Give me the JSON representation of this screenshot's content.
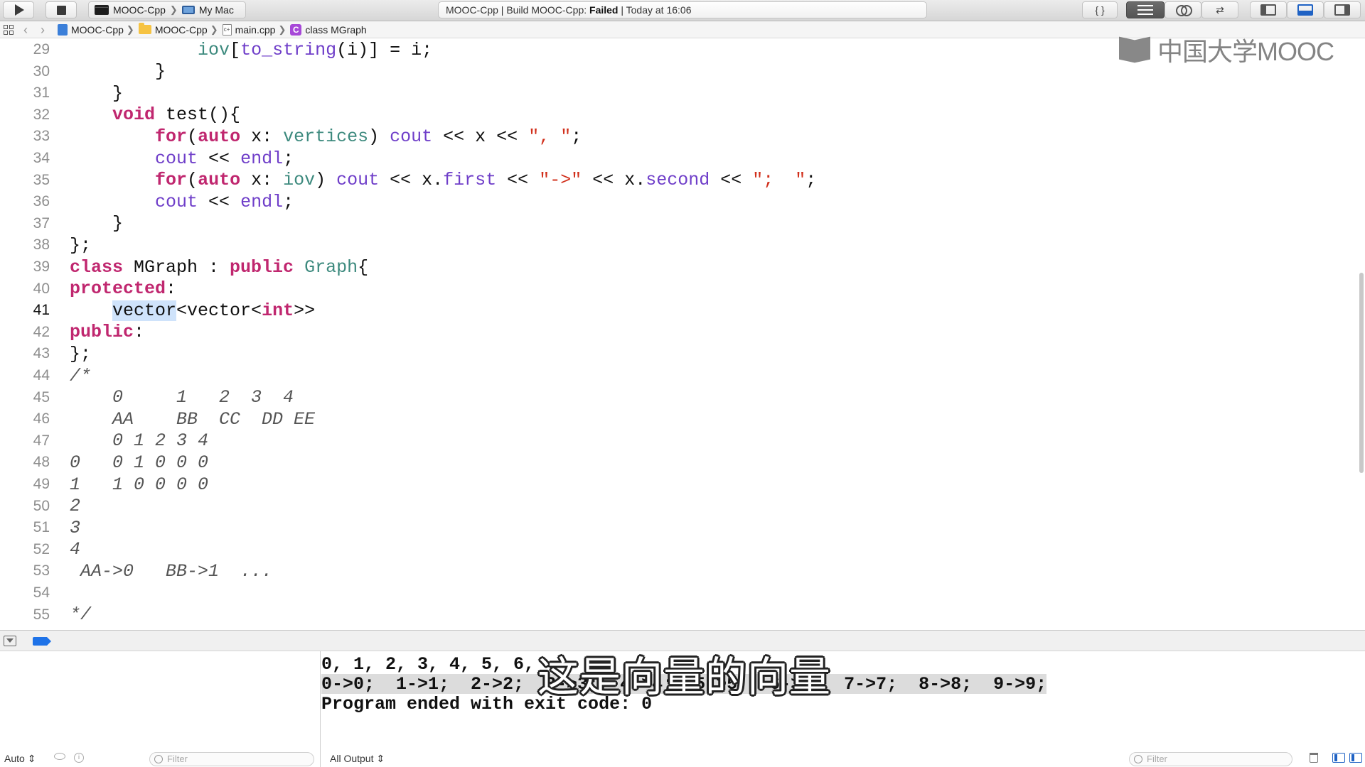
{
  "toolbar": {
    "scheme_target": "MOOC-Cpp",
    "scheme_destination": "My Mac",
    "activity_prefix": "MOOC-Cpp | Build MOOC-Cpp: ",
    "activity_status": "Failed",
    "activity_suffix": " | Today at 16:06",
    "braces_label": "{ }"
  },
  "jumpbar": {
    "crumbs": [
      "MOOC-Cpp",
      "MOOC-Cpp",
      "main.cpp",
      "class MGraph"
    ]
  },
  "watermark": {
    "text": "中国大学MOOC"
  },
  "editor": {
    "current_line": "41",
    "lines": [
      {
        "n": "29",
        "tokens": [
          {
            "t": "            ",
            "c": ""
          },
          {
            "t": "iov",
            "c": "type"
          },
          {
            "t": "[",
            "c": ""
          },
          {
            "t": "to_string",
            "c": "method"
          },
          {
            "t": "(i)] = i;",
            "c": ""
          }
        ]
      },
      {
        "n": "30",
        "tokens": [
          {
            "t": "        }",
            "c": ""
          }
        ]
      },
      {
        "n": "31",
        "tokens": [
          {
            "t": "    }",
            "c": ""
          }
        ]
      },
      {
        "n": "32",
        "tokens": [
          {
            "t": "    ",
            "c": ""
          },
          {
            "t": "void",
            "c": "keyword"
          },
          {
            "t": " test(){",
            "c": ""
          }
        ]
      },
      {
        "n": "33",
        "tokens": [
          {
            "t": "        ",
            "c": ""
          },
          {
            "t": "for",
            "c": "keyword"
          },
          {
            "t": "(",
            "c": ""
          },
          {
            "t": "auto",
            "c": "keyword"
          },
          {
            "t": " x: ",
            "c": ""
          },
          {
            "t": "vertices",
            "c": "type"
          },
          {
            "t": ") ",
            "c": ""
          },
          {
            "t": "cout",
            "c": "method"
          },
          {
            "t": " << x << ",
            "c": ""
          },
          {
            "t": "\", \"",
            "c": "string"
          },
          {
            "t": ";",
            "c": ""
          }
        ]
      },
      {
        "n": "34",
        "tokens": [
          {
            "t": "        ",
            "c": ""
          },
          {
            "t": "cout",
            "c": "method"
          },
          {
            "t": " << ",
            "c": ""
          },
          {
            "t": "endl",
            "c": "method"
          },
          {
            "t": ";",
            "c": ""
          }
        ]
      },
      {
        "n": "35",
        "tokens": [
          {
            "t": "        ",
            "c": ""
          },
          {
            "t": "for",
            "c": "keyword"
          },
          {
            "t": "(",
            "c": ""
          },
          {
            "t": "auto",
            "c": "keyword"
          },
          {
            "t": " x: ",
            "c": ""
          },
          {
            "t": "iov",
            "c": "type"
          },
          {
            "t": ") ",
            "c": ""
          },
          {
            "t": "cout",
            "c": "method"
          },
          {
            "t": " << x.",
            "c": ""
          },
          {
            "t": "first",
            "c": "method"
          },
          {
            "t": " << ",
            "c": ""
          },
          {
            "t": "\"->\"",
            "c": "string"
          },
          {
            "t": " << x.",
            "c": ""
          },
          {
            "t": "second",
            "c": "method"
          },
          {
            "t": " << ",
            "c": ""
          },
          {
            "t": "\";  \"",
            "c": "string"
          },
          {
            "t": ";",
            "c": ""
          }
        ]
      },
      {
        "n": "36",
        "tokens": [
          {
            "t": "        ",
            "c": ""
          },
          {
            "t": "cout",
            "c": "method"
          },
          {
            "t": " << ",
            "c": ""
          },
          {
            "t": "endl",
            "c": "method"
          },
          {
            "t": ";",
            "c": ""
          }
        ]
      },
      {
        "n": "37",
        "tokens": [
          {
            "t": "    }",
            "c": ""
          }
        ]
      },
      {
        "n": "38",
        "tokens": [
          {
            "t": "};",
            "c": ""
          }
        ]
      },
      {
        "n": "39",
        "tokens": [
          {
            "t": "class",
            "c": "keyword"
          },
          {
            "t": " MGraph : ",
            "c": ""
          },
          {
            "t": "public",
            "c": "keyword"
          },
          {
            "t": " ",
            "c": ""
          },
          {
            "t": "Graph",
            "c": "type"
          },
          {
            "t": "{",
            "c": ""
          }
        ]
      },
      {
        "n": "40",
        "tokens": [
          {
            "t": "protected",
            "c": "keyword"
          },
          {
            "t": ":",
            "c": ""
          }
        ]
      },
      {
        "n": "41",
        "tokens": [
          {
            "t": "    ",
            "c": ""
          },
          {
            "t": "vector",
            "c": "selected"
          },
          {
            "t": "<vector<",
            "c": ""
          },
          {
            "t": "int",
            "c": "keyword"
          },
          {
            "t": ">>",
            "c": ""
          }
        ]
      },
      {
        "n": "42",
        "tokens": [
          {
            "t": "public",
            "c": "keyword"
          },
          {
            "t": ":",
            "c": ""
          }
        ]
      },
      {
        "n": "43",
        "tokens": [
          {
            "t": "};",
            "c": ""
          }
        ]
      },
      {
        "n": "44",
        "tokens": [
          {
            "t": "/*",
            "c": "comment"
          }
        ]
      },
      {
        "n": "45",
        "tokens": [
          {
            "t": "    0     1   2  3  4",
            "c": "comment"
          }
        ]
      },
      {
        "n": "46",
        "tokens": [
          {
            "t": "    AA    BB  CC  DD EE",
            "c": "comment"
          }
        ]
      },
      {
        "n": "47",
        "tokens": [
          {
            "t": "    0 1 2 3 4",
            "c": "comment"
          }
        ]
      },
      {
        "n": "48",
        "tokens": [
          {
            "t": "0   0 1 0 0 0",
            "c": "comment"
          }
        ]
      },
      {
        "n": "49",
        "tokens": [
          {
            "t": "1   1 0 0 0 0",
            "c": "comment"
          }
        ]
      },
      {
        "n": "50",
        "tokens": [
          {
            "t": "2",
            "c": "comment"
          }
        ]
      },
      {
        "n": "51",
        "tokens": [
          {
            "t": "3",
            "c": "comment"
          }
        ]
      },
      {
        "n": "52",
        "tokens": [
          {
            "t": "4",
            "c": "comment"
          }
        ]
      },
      {
        "n": "53",
        "tokens": [
          {
            "t": " AA->0   BB->1  ...",
            "c": "comment"
          }
        ]
      },
      {
        "n": "54",
        "tokens": []
      },
      {
        "n": "55",
        "tokens": [
          {
            "t": "*/",
            "c": "comment"
          }
        ]
      }
    ]
  },
  "console": {
    "output_lines": [
      "0, 1, 2, 3, 4, 5, 6,",
      "0->0;  1->1;  2->2;  3->3;  4->4;  5->5;  6->6;  7->7;  8->8;  9->9;",
      "Program ended with exit code: 0"
    ],
    "highlighted_line": 1,
    "subtitle": "这是向量的向量",
    "variables_scope": "Auto ⇕",
    "output_scope": "All Output ⇕",
    "filter_placeholder": "Filter"
  },
  "colors": {
    "keyword": "#c0276f",
    "type": "#3d8a7e",
    "method": "#6f3ec9",
    "string": "#d12f1b",
    "selection": "#cfe3fb",
    "status_failed": "#111111"
  }
}
